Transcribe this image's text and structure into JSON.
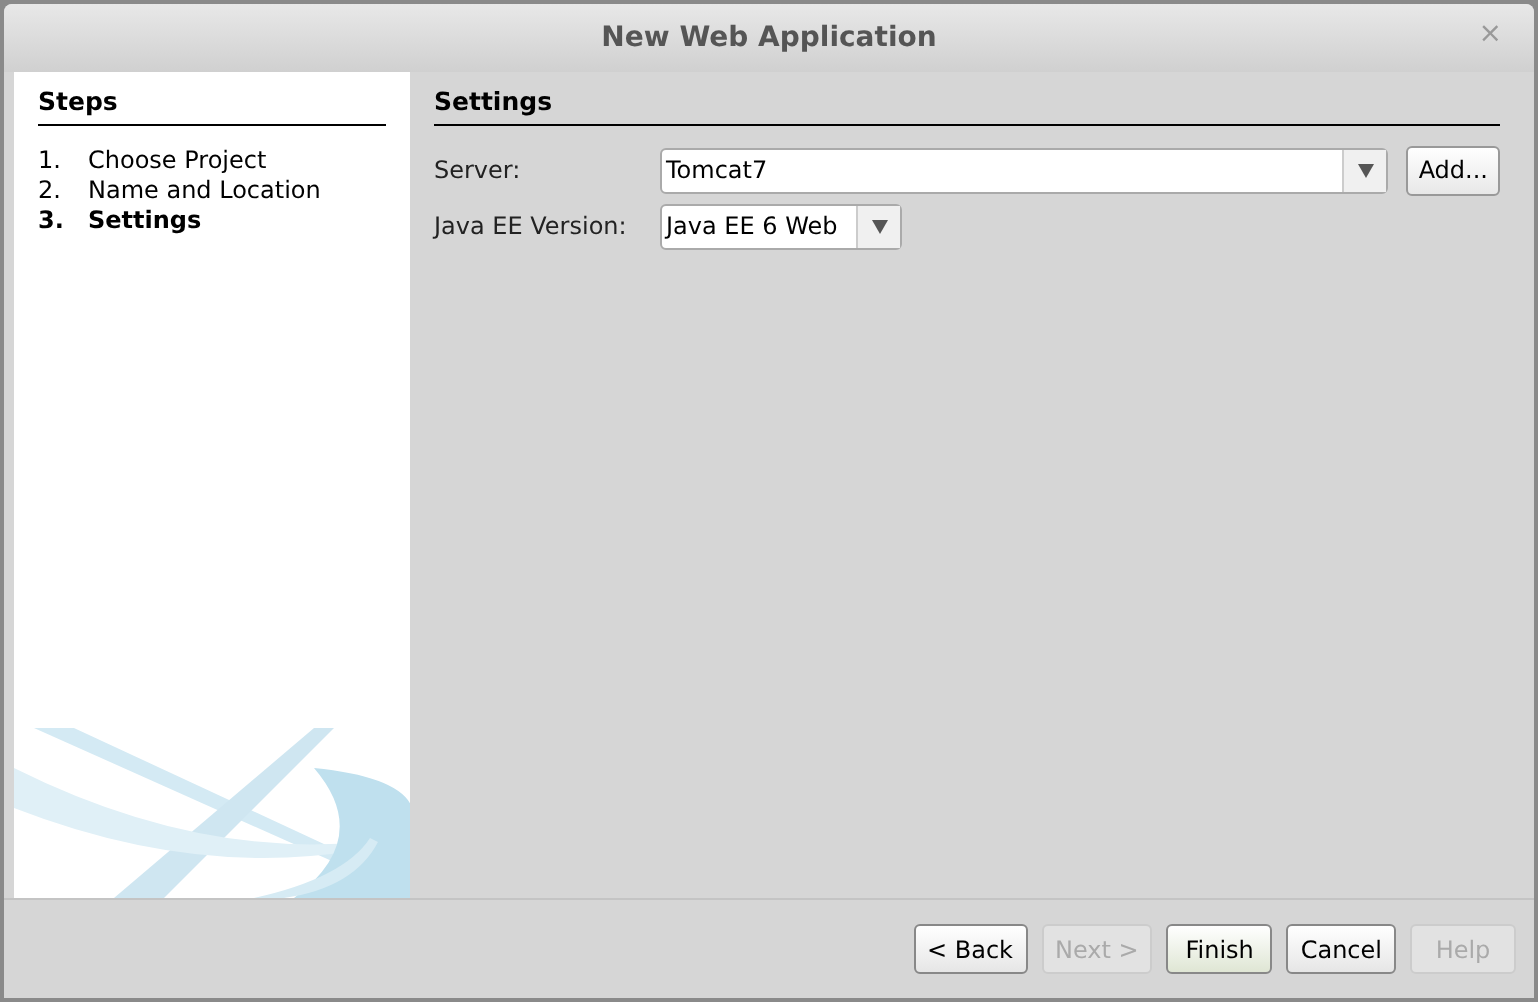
{
  "window": {
    "title": "New Web Application",
    "close": "×"
  },
  "steps": {
    "title": "Steps",
    "items": [
      {
        "number": "1.",
        "label": "Choose Project",
        "selected": false
      },
      {
        "number": "2.",
        "label": "Name and Location",
        "selected": false
      },
      {
        "number": "3.",
        "label": "Settings",
        "selected": true
      }
    ]
  },
  "panel": {
    "title": "Settings",
    "fields": [
      {
        "label": "Server:",
        "value": "Tomcat7",
        "button": "Add..."
      },
      {
        "label": "Java EE Version:",
        "value": "Java EE 6 Web"
      }
    ]
  },
  "buttons": [
    {
      "label": "< Back",
      "disabled": false
    },
    {
      "label": "Next >",
      "disabled": true
    },
    {
      "label": "Finish",
      "disabled": false,
      "default": true
    },
    {
      "label": "Cancel",
      "disabled": false
    },
    {
      "label": "Help",
      "disabled": true
    }
  ]
}
